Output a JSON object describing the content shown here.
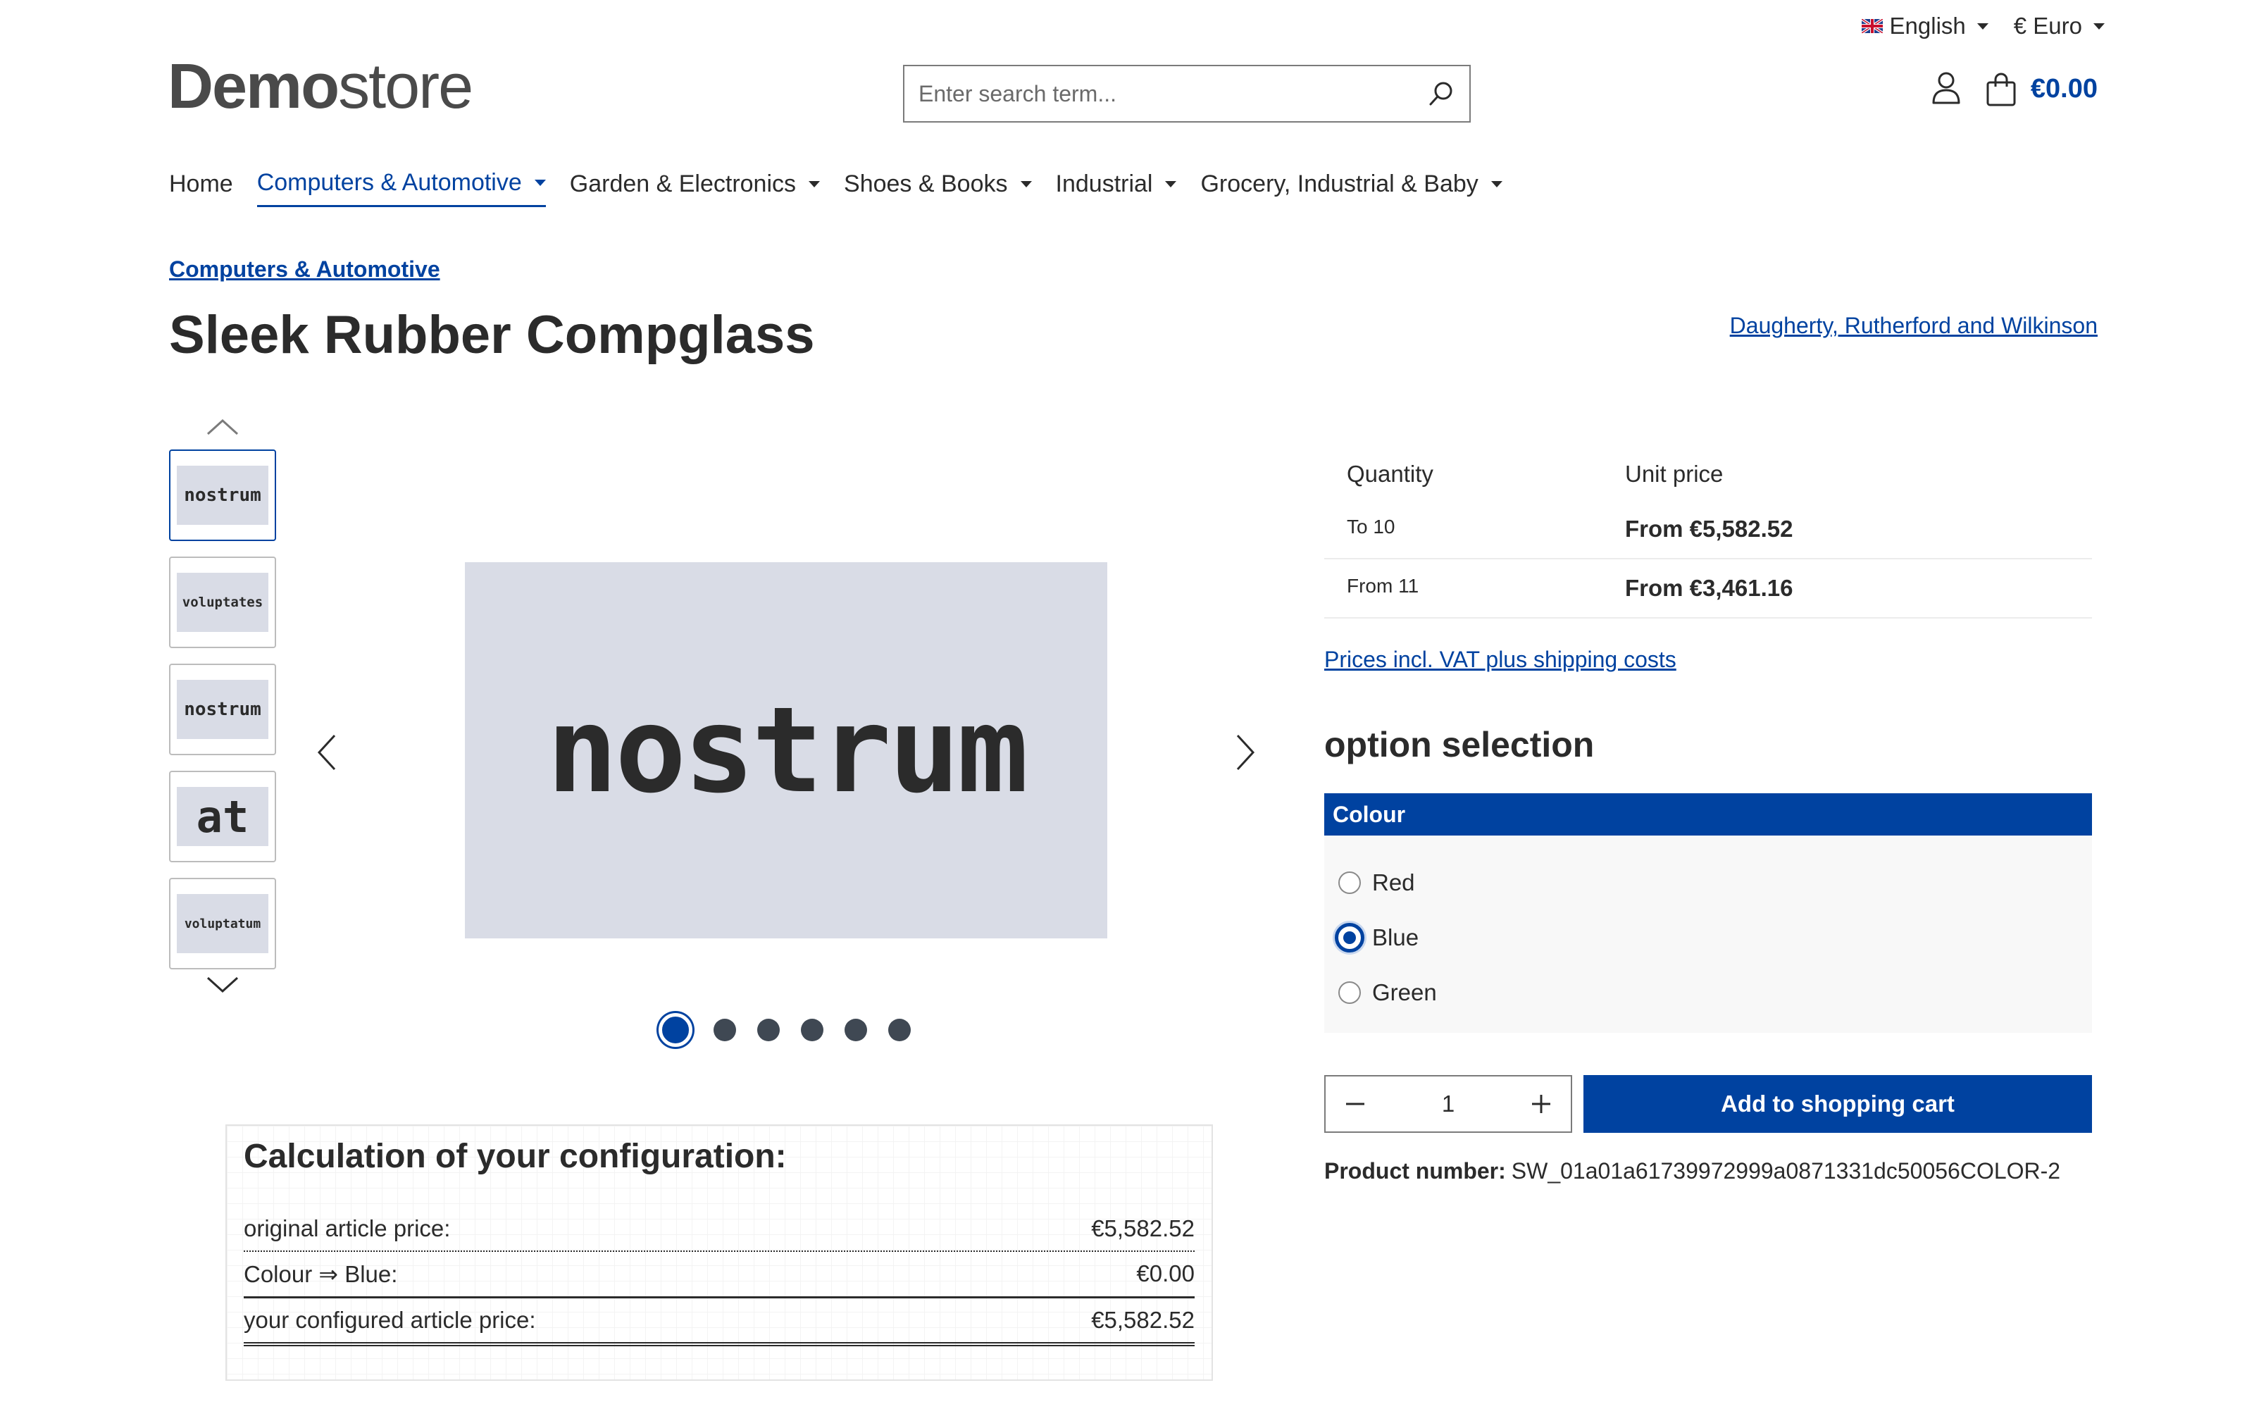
{
  "topbar": {
    "language": "English",
    "currency": "€ Euro"
  },
  "header": {
    "logo_strong": "Demo",
    "logo_light": "store",
    "search_placeholder": "Enter search term...",
    "cart_total": "€0.00"
  },
  "nav": {
    "items": [
      {
        "label": "Home"
      },
      {
        "label": "Computers & Automotive"
      },
      {
        "label": "Garden & Electronics"
      },
      {
        "label": "Shoes & Books"
      },
      {
        "label": "Industrial"
      },
      {
        "label": "Grocery, Industrial & Baby"
      }
    ]
  },
  "product": {
    "breadcrumb": "Computers & Automotive",
    "title": "Sleek Rubber Compglass",
    "manufacturer": "Daugherty, Rutherford and Wilkinson",
    "main_image_text": "nostrum",
    "thumbnails": [
      "nostrum",
      "voluptates",
      "nostrum",
      "at",
      "voluptatum"
    ],
    "product_number_label": "Product number:",
    "product_number": "SW_01a01a61739972999a0871331dc50056COLOR-2"
  },
  "prices": {
    "col_quantity": "Quantity",
    "col_unit_price": "Unit price",
    "rows": [
      {
        "qty": "To 10",
        "price": "From €5,582.52"
      },
      {
        "qty": "From 11",
        "price": "From €3,461.16"
      }
    ],
    "vat_link": "Prices incl. VAT plus shipping costs"
  },
  "options": {
    "title": "option selection",
    "group_label": "Colour",
    "choices": [
      "Red",
      "Blue",
      "Green"
    ],
    "selected": "Blue"
  },
  "buy": {
    "quantity": "1",
    "add_to_cart": "Add to shopping cart"
  },
  "calculation": {
    "title": "Calculation of your configuration:",
    "rows": [
      {
        "label": "original article price:",
        "value": "€5,582.52"
      },
      {
        "label": "Colour ⇒ Blue:",
        "value": "€0.00"
      },
      {
        "label": "your configured article price:",
        "value": "€5,582.52"
      }
    ]
  },
  "colors": {
    "accent": "#0042a0",
    "image_bg": "#d9dce6",
    "text": "#2b2b2b"
  }
}
